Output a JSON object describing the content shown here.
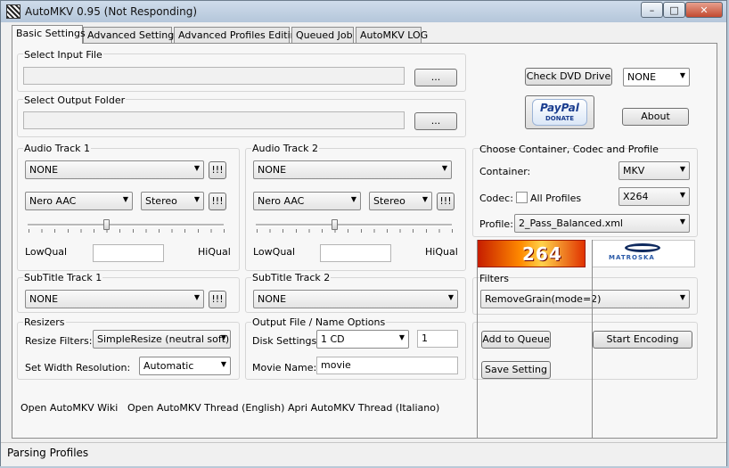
{
  "window": {
    "title": "AutoMKV 0.95 (Not Responding)"
  },
  "tabs": [
    "Basic Settings",
    "Advanced Settings",
    "Advanced Profiles Editing",
    "Queued Job",
    "AutoMKV LOG"
  ],
  "input_file": {
    "label": "Select Input File",
    "value": "",
    "browse": "..."
  },
  "output_folder": {
    "label": "Select Output Folder",
    "value": "",
    "browse": "..."
  },
  "dvd": {
    "check_button": "Check DVD Drive",
    "drive_value": "NONE"
  },
  "paypal": {
    "line1": "PayPal",
    "line2": "DONATE"
  },
  "about_button": "About",
  "audio1": {
    "title": "Audio Track 1",
    "track": "NONE",
    "codec": "Nero AAC",
    "channels": "Stereo",
    "bang": "!!!",
    "low": "LowQual",
    "high": "HiQual",
    "quality": "",
    "level": 0.4
  },
  "audio2": {
    "title": "Audio Track 2",
    "track": "NONE",
    "codec": "Nero AAC",
    "channels": "Stereo",
    "bang": "!!!",
    "low": "LowQual",
    "high": "HiQual",
    "quality": "",
    "level": 0.4
  },
  "container_group": {
    "title": "Choose Container, Codec and Profile",
    "container_label": "Container:",
    "container_value": "MKV",
    "codec_label": "Codec:",
    "all_profiles": "All Profiles",
    "codec_value": "X264",
    "profile_label": "Profile:",
    "profile_value": "2_Pass_Balanced.xml"
  },
  "logos": {
    "x264": "264",
    "matroska": "MATROSKA"
  },
  "subtitle1": {
    "title": "SubTitle Track 1",
    "value": "NONE",
    "bang": "!!!"
  },
  "subtitle2": {
    "title": "SubTitle Track 2",
    "value": "NONE"
  },
  "filters": {
    "title": "Filters",
    "value": "RemoveGrain(mode=2)"
  },
  "resizers": {
    "title": "Resizers",
    "filter_label": "Resize Filters:",
    "filter_value": "SimpleResize (neutral soft)",
    "width_label": "Set Width Resolution:",
    "width_value": "Automatic"
  },
  "output_opts": {
    "title": "Output File / Name Options",
    "disk_label": "Disk Settings:",
    "disk_value": "1 CD",
    "disk_count": "1",
    "movie_label": "Movie Name:",
    "movie_value": "movie"
  },
  "actions": {
    "add_queue": "Add to Queue",
    "start": "Start Encoding",
    "save": "Save Setting"
  },
  "links": {
    "wiki": "Open AutoMKV Wiki",
    "thread_en": "Open AutoMKV Thread (English)",
    "thread_it": "Apri AutoMKV Thread (Italiano)"
  },
  "status": "Parsing Profiles"
}
